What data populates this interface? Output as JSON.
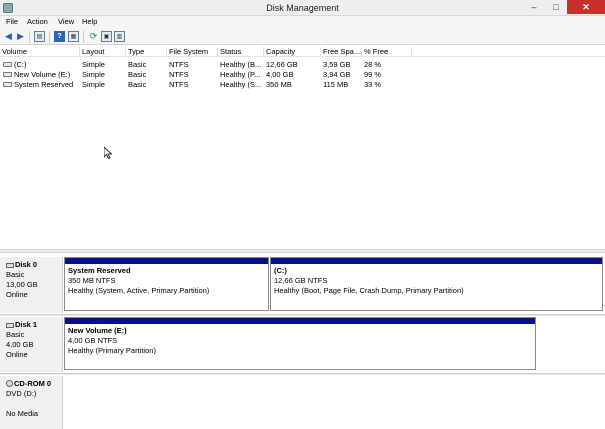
{
  "window": {
    "title": "Disk Management",
    "minimize": "–",
    "maximize": "□",
    "close": "✕"
  },
  "menu": [
    "File",
    "Action",
    "View",
    "Help"
  ],
  "columns": [
    "Volume",
    "Layout",
    "Type",
    "File System",
    "Status",
    "Capacity",
    "Free Spa...",
    "% Free"
  ],
  "volumes": [
    {
      "volume": "(C:)",
      "layout": "Simple",
      "type": "Basic",
      "fs": "NTFS",
      "status": "Healthy (B...",
      "capacity": "12,66 GB",
      "free": "3,59 GB",
      "pct": "28 %"
    },
    {
      "volume": "New Volume (E:)",
      "layout": "Simple",
      "type": "Basic",
      "fs": "NTFS",
      "status": "Healthy (P...",
      "capacity": "4,00 GB",
      "free": "3,94 GB",
      "pct": "99 %"
    },
    {
      "volume": "System Reserved",
      "layout": "Simple",
      "type": "Basic",
      "fs": "NTFS",
      "status": "Healthy (S...",
      "capacity": "350 MB",
      "free": "115 MB",
      "pct": "33 %"
    }
  ],
  "disks": [
    {
      "name": "Disk 0",
      "type": "Basic",
      "size": "13,00 GB",
      "state": "Online",
      "partitions": [
        {
          "name": "System Reserved",
          "size": "350 MB NTFS",
          "status": "Healthy (System, Active, Primary Partition)"
        },
        {
          "name": "(C:)",
          "size": "12,66 GB NTFS",
          "status": "Healthy (Boot, Page File, Crash Dump, Primary Partition)"
        }
      ]
    },
    {
      "name": "Disk 1",
      "type": "Basic",
      "size": "4,00 GB",
      "state": "Online",
      "partitions": [
        {
          "name": "New Volume  (E:)",
          "size": "4,00 GB NTFS",
          "status": "Healthy (Primary Partition)"
        }
      ]
    }
  ],
  "cdrom": {
    "name": "CD-ROM 0",
    "drive": "DVD (D:)",
    "media": "No Media"
  },
  "colors": {
    "partition_header": "#0a0e8c",
    "close_button": "#c7312a"
  },
  "icons": [
    "back-arrow-icon",
    "forward-arrow-icon",
    "console-tree-icon",
    "help-icon",
    "properties-icon",
    "refresh-icon",
    "disk-settings-icon"
  ]
}
